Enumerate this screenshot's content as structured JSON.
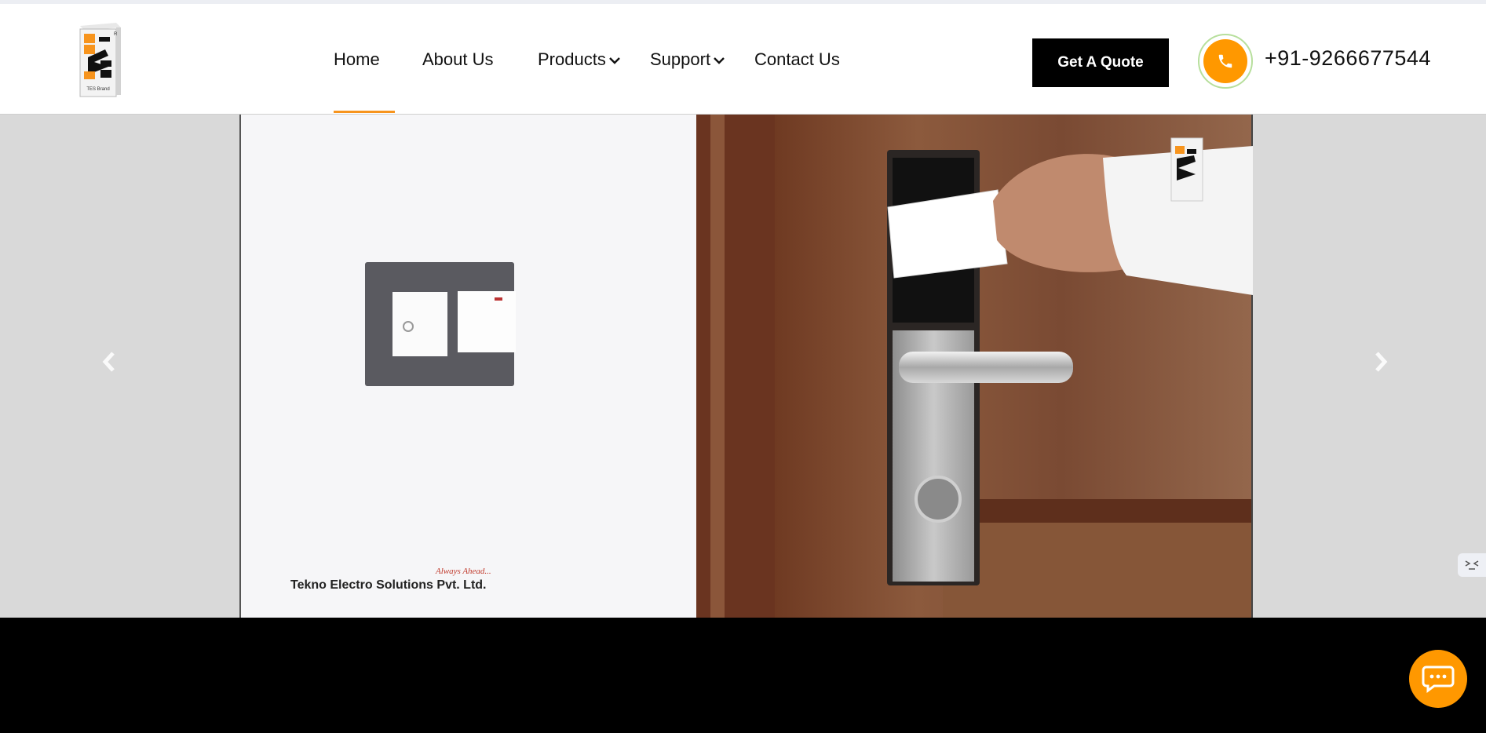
{
  "header": {
    "logo": {
      "icon": "tes-brand-logo",
      "text": "TES Brand",
      "colors": {
        "orange": "#f7941d",
        "black": "#111111"
      }
    },
    "nav": [
      {
        "label": "Home",
        "active": true
      },
      {
        "label": "About Us"
      },
      {
        "label": "Products",
        "dropdown": true
      },
      {
        "label": "Support",
        "dropdown": true
      },
      {
        "label": "Contact Us"
      }
    ],
    "quote_label": "Get A Quote",
    "phone": {
      "icon": "phone-icon",
      "number": "+91-9266677544",
      "accent": "#ff9800"
    }
  },
  "hero": {
    "prev_icon": "chevron-left-icon",
    "next_icon": "chevron-right-icon",
    "slide": {
      "tagline": "Always Ahead...",
      "company": "Tekno Electro Solutions Pvt. Ltd."
    }
  },
  "chat": {
    "icon": "chat-bubble-icon",
    "color": "#ff9800"
  },
  "side_widget": {
    "icon": "code-icon"
  }
}
